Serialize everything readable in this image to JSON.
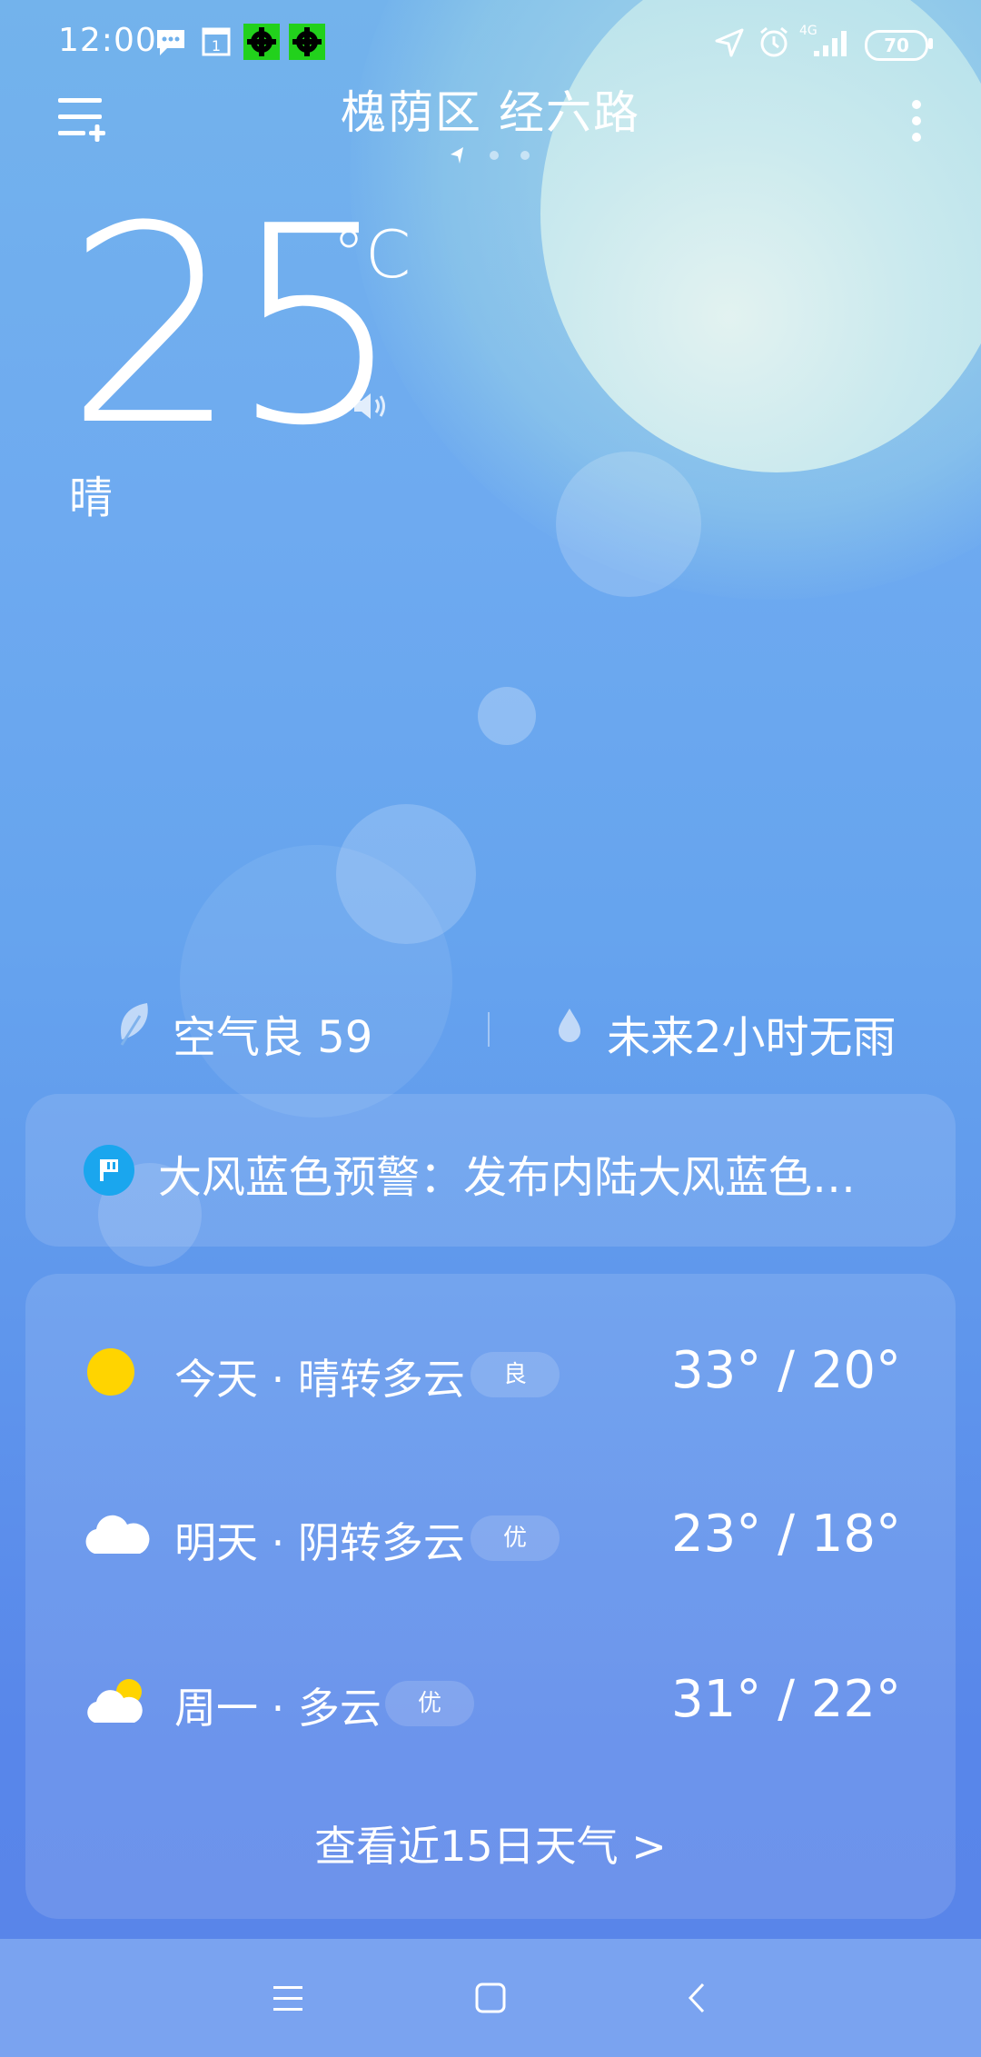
{
  "status_bar": {
    "time": "12:00",
    "network": "4G",
    "battery": "70",
    "icons": [
      "message-icon",
      "calendar-icon",
      "app-gear-icon",
      "app-gear-icon",
      "location-arrow-icon",
      "alarm-icon",
      "signal-icon",
      "battery-icon"
    ]
  },
  "header": {
    "city": "槐荫区 经六路",
    "menu_icon": "menu-add-icon",
    "more_icon": "more-vertical-icon"
  },
  "current": {
    "temperature": "25",
    "unit": "°C",
    "condition": "晴"
  },
  "air": {
    "label": "空气良 59",
    "icon": "leaf-icon"
  },
  "rain": {
    "label": "未来2小时无雨",
    "icon": "drop-icon"
  },
  "alert": {
    "text": "大风蓝色预警：发布内陆大风蓝色…",
    "icon": "warning-flag-icon",
    "color": "#1aa6ee"
  },
  "forecast": [
    {
      "day": "今天 · 晴转多云",
      "aqi": "良",
      "temps": "33° /  20°",
      "icon": "sun-icon"
    },
    {
      "day": "明天 · 阴转多云",
      "aqi": "优",
      "temps": "23° /  18°",
      "icon": "cloud-icon"
    },
    {
      "day": "周一 · 多云",
      "aqi": "优",
      "temps": "31° /  22°",
      "icon": "partly-cloudy-icon"
    }
  ],
  "more_forecast": "查看近15日天气  >",
  "nav": {
    "buttons": [
      "menu-icon",
      "home-icon",
      "back-icon"
    ]
  },
  "colors": {
    "sun": "#ffd400",
    "alert_blue": "#1aa6ee",
    "background_top": "#73b3ec",
    "background_bottom": "#5a84e8"
  }
}
